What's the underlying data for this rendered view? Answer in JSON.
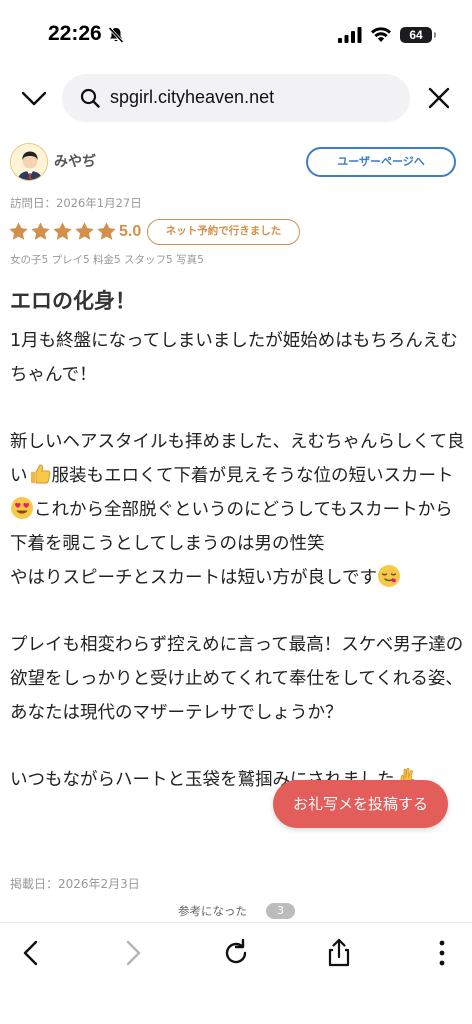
{
  "status_bar": {
    "time": "22:26",
    "battery": "64"
  },
  "url_bar": {
    "url": "spgirl.cityheaven.net"
  },
  "review": {
    "username": "みやぢ",
    "user_page_label": "ユーザーページへ",
    "visit_date": "訪問日：2026年1月27日",
    "star_count": 5,
    "rating": "5.0",
    "net_badge": "ネット予約で行きました",
    "subscores": "女の子5 プレイ5 料金5 スタッフ5 写真5",
    "title": "エロの化身！",
    "body": {
      "p1": "1月も終盤になってしまいましたが姫始めはもちろんえむちゃんで！",
      "p2a": "新しいヘアスタイルも拝めました、えむちゃんらしくて良い",
      "p2b": "服装もエロくて下着が見えそうな位の短いスカート",
      "p2c": "これから全部脱ぐというのにどうしてもスカートから下着を覗こうとしてしまうのは男の性笑",
      "p3": "やはりスピーチとスカートは短い方が良しです",
      "p4": "プレイも相変わらず控えめに言って最高！スケベ男子達の欲望をしっかりと受け止めてくれて奉仕をしてくれる姿、あなたは現代のマザーテレサでしょうか？",
      "p5": "いつもながらハートと玉袋を鷲掴みにされました"
    },
    "post_photo_label": "お礼写メを投稿する",
    "post_date": "掲載日：2026年2月3日",
    "helpful_label": "参考になった",
    "helpful_count": "3"
  },
  "colors": {
    "accent_blue": "#3d7cc9",
    "star_orange": "#d4904a",
    "post_button": "#e35d5b"
  },
  "icons": [
    "bell-slash-icon",
    "signal-icon",
    "wifi-icon",
    "chevron-down-icon",
    "search-icon",
    "close-icon",
    "back-icon",
    "forward-icon",
    "reload-icon",
    "share-icon",
    "more-icon"
  ]
}
